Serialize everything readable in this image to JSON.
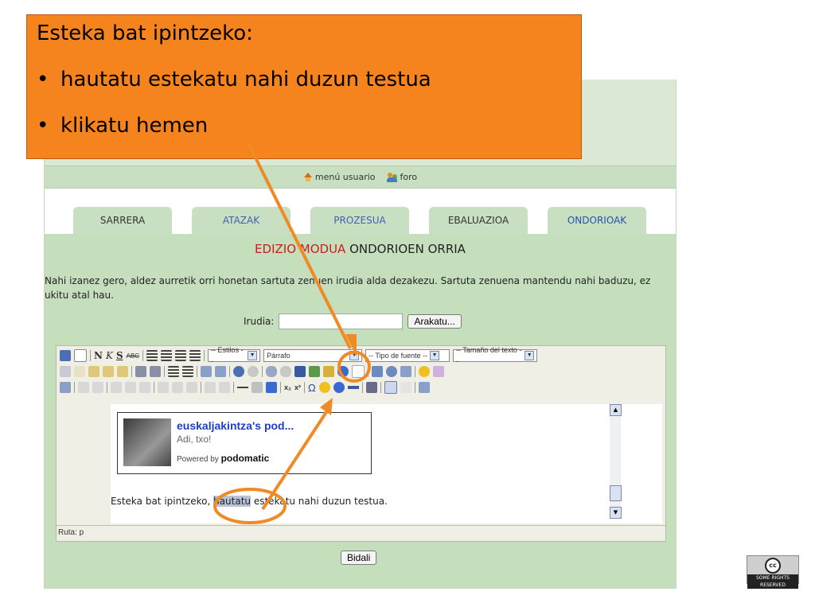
{
  "callout": {
    "title": "Esteka bat ipintzeko:",
    "bullet1": "hautatu estekatu nahi duzun testua",
    "bullet2": "klikatu hemen"
  },
  "menu": {
    "user_menu": "menú usuario",
    "forum": "foro"
  },
  "tabs": [
    {
      "label": "SARRERA"
    },
    {
      "label": "ATAZAK"
    },
    {
      "label": "PROZESUA"
    },
    {
      "label": "EBALUAZIOA"
    },
    {
      "label": "ONDORIOAK"
    }
  ],
  "page": {
    "title_mode": "EDIZIO MODUA",
    "title_page": "ONDORIOEN ORRIA",
    "description": "Nahi izanez gero, aldez aurretik orri honetan sartuta zenuen irudia alda dezakezu. Sartuta zenuena mantendu nahi baduzu, ez ukitu atal hau.",
    "image_label": "Irudia:",
    "browse_button": "Arakatu...",
    "submit_button": "Bidali"
  },
  "toolbar": {
    "styles": "-- Estilos --",
    "format": "Párrafo",
    "font": "-- Tipo de fuente --",
    "size": "-- Tamaño del texto --",
    "bold": "N",
    "italic": "K",
    "underline": "S",
    "strike": "ABC",
    "omega": "Ω",
    "sub": "x₂",
    "sup": "x²"
  },
  "editor": {
    "pod_title": "euskaljakintza's pod...",
    "pod_subtitle": "Adi, txo!",
    "pod_powered": "Powered by",
    "pod_logo": "podomatic",
    "text_before": "Esteka bat ipintzeko, ",
    "text_highlight": "hautatu",
    "text_after": " estekatu nahi duzun testua.",
    "path": "Ruta: p"
  },
  "license": {
    "text": "SOME RIGHTS RESERVED",
    "symbol": "cc"
  },
  "colors": {
    "callout": "#f5841f",
    "panel": "#c5dfbd",
    "annotation": "#f08a24",
    "title_red": "#c81e1e"
  }
}
